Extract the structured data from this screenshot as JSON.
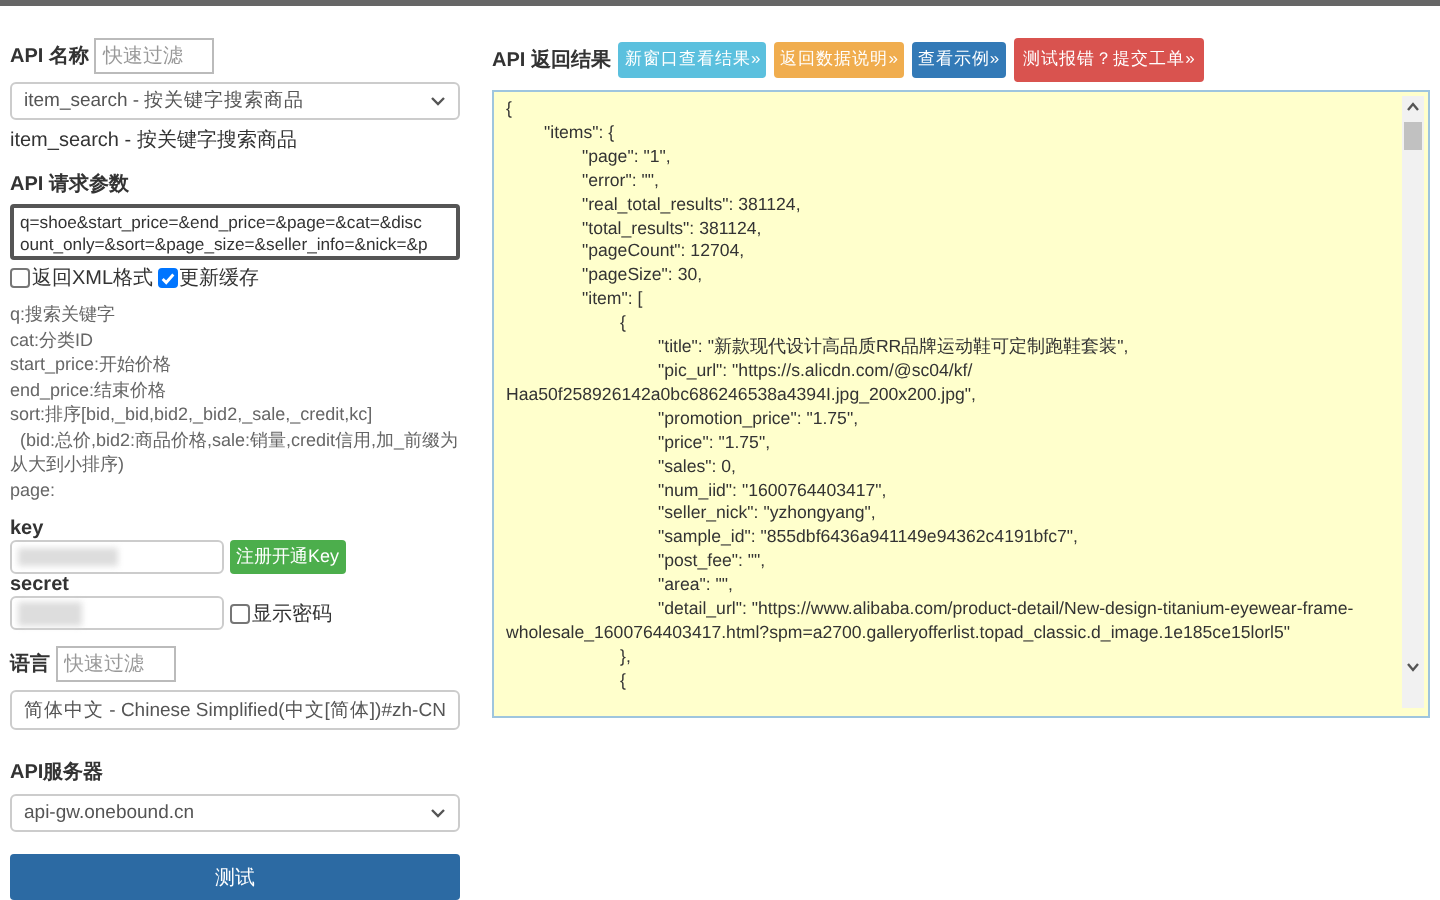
{
  "api_name": {
    "label": "API 名称",
    "filter_placeholder": "快速过滤",
    "selected": "item_search - 按关键字搜索商品",
    "description": "item_search - 按关键字搜索商品"
  },
  "params": {
    "label": "API 请求参数",
    "value": "q=shoe&start_price=&end_price=&page=&cat=&discount_only=&sort=&page_size=&seller_info=&nick=&p",
    "options": [
      {
        "label": "返回XML格式",
        "checked": false
      },
      {
        "label": "更新缓存",
        "checked": true
      }
    ],
    "help": [
      "q:搜索关键字",
      "cat:分类ID",
      "start_price:开始价格",
      "end_price:结束价格",
      "sort:排序[bid,_bid,bid2,_bid2,_sale,_credit,kc]",
      "  (bid:总价,bid2:商品价格,sale:销量,credit信用,加_前缀为从大到小排序)",
      "page:"
    ]
  },
  "key": {
    "label": "key",
    "register_button": "注册开通Key"
  },
  "secret": {
    "label": "secret",
    "show_password": {
      "label": "显示密码",
      "checked": false
    }
  },
  "language": {
    "label": "语言",
    "filter_placeholder": "快速过滤",
    "selected": "简体中文 - Chinese Simplified(中文[简体])#zh-CN"
  },
  "server": {
    "label": "API服务器",
    "selected": "api-gw.onebound.cn"
  },
  "test_button": "测试",
  "result": {
    "label": "API 返回结果",
    "buttons": [
      {
        "label": "新窗口查看结果»",
        "kind": "info"
      },
      {
        "label": "返回数据说明»",
        "kind": "warning"
      },
      {
        "label": "查看示例»",
        "kind": "primary"
      },
      {
        "label": "测试报错？提交工单»",
        "kind": "danger"
      }
    ],
    "text": "{\n\t\"items\": {\n\t\t\"page\": \"1\",\n\t\t\"error\": \"\",\n\t\t\"real_total_results\": 381124,\n\t\t\"total_results\": 381124,\n\t\t\"pageCount\": 12704,\n\t\t\"pageSize\": 30,\n\t\t\"item\": [\n\t\t\t{\n\t\t\t\t\"title\": \"新款现代设计高品质RR品牌运动鞋可定制跑鞋套装\",\n\t\t\t\t\"pic_url\": \"https://s.alicdn.com/@sc04/kf/\nHaa50f258926142a0bc686246538a4394I.jpg_200x200.jpg\",\n\t\t\t\t\"promotion_price\": \"1.75\",\n\t\t\t\t\"price\": \"1.75\",\n\t\t\t\t\"sales\": 0,\n\t\t\t\t\"num_iid\": \"1600764403417\",\n\t\t\t\t\"seller_nick\": \"yzhongyang\",\n\t\t\t\t\"sample_id\": \"855dbf6436a941149e94362c4191bfc7\",\n\t\t\t\t\"post_fee\": \"\",\n\t\t\t\t\"area\": \"\",\n\t\t\t\t\"detail_url\": \"https://www.alibaba.com/product-detail/New-design-titanium-eyewear-frame-\nwholesale_1600764403417.html?spm=a2700.galleryofferlist.topad_classic.d_image.1e185ce15lorl5\"\n\t\t\t},\n\t\t\t{"
  }
}
